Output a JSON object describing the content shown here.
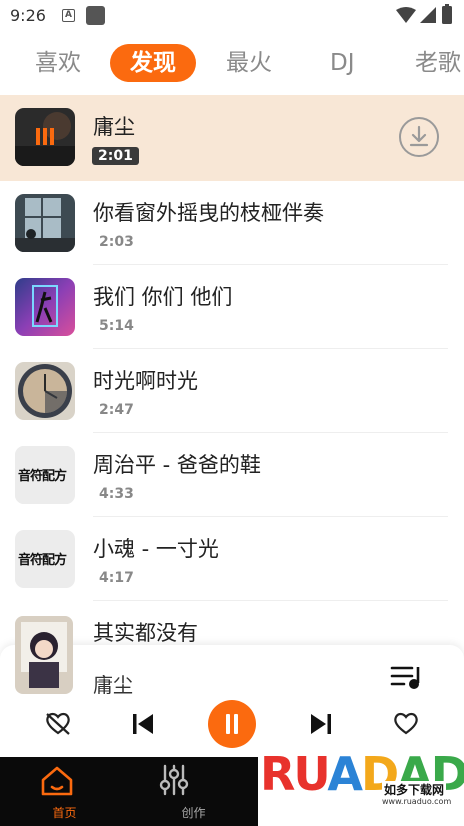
{
  "status_bar": {
    "time": "9:26",
    "notif_letter": "A"
  },
  "tabs": [
    {
      "label": "喜欢",
      "active": false
    },
    {
      "label": "发现",
      "active": true
    },
    {
      "label": "最火",
      "active": false
    },
    {
      "label": "DJ",
      "active": false
    },
    {
      "label": "老歌",
      "active": false
    }
  ],
  "songs": [
    {
      "title": "庸尘",
      "duration": "2:01",
      "playing": true
    },
    {
      "title": "你看窗外摇曳的枝桠伴奏",
      "duration": "2:03"
    },
    {
      "title": "我们 你们 他们",
      "duration": "5:14"
    },
    {
      "title": "时光啊时光",
      "duration": "2:47"
    },
    {
      "title": "周治平 - 爸爸的鞋",
      "duration": "4:33"
    },
    {
      "title": "小魂 - 一寸光",
      "duration": "4:17"
    },
    {
      "title": "其实都没有",
      "duration": ""
    }
  ],
  "cover_text": "音符配方",
  "player": {
    "title": "庸尘"
  },
  "bottom_nav": [
    {
      "label": "首页",
      "active": true
    },
    {
      "label": "创作",
      "active": false
    }
  ],
  "watermark": {
    "logo": "RUANDAO",
    "cn": "如多下载网",
    "url": "www.ruaduo.com"
  },
  "colors": {
    "accent": "#fb6a0f",
    "current_row_bg": "#f8e7d6",
    "nav_bg": "#0a0a0a"
  }
}
